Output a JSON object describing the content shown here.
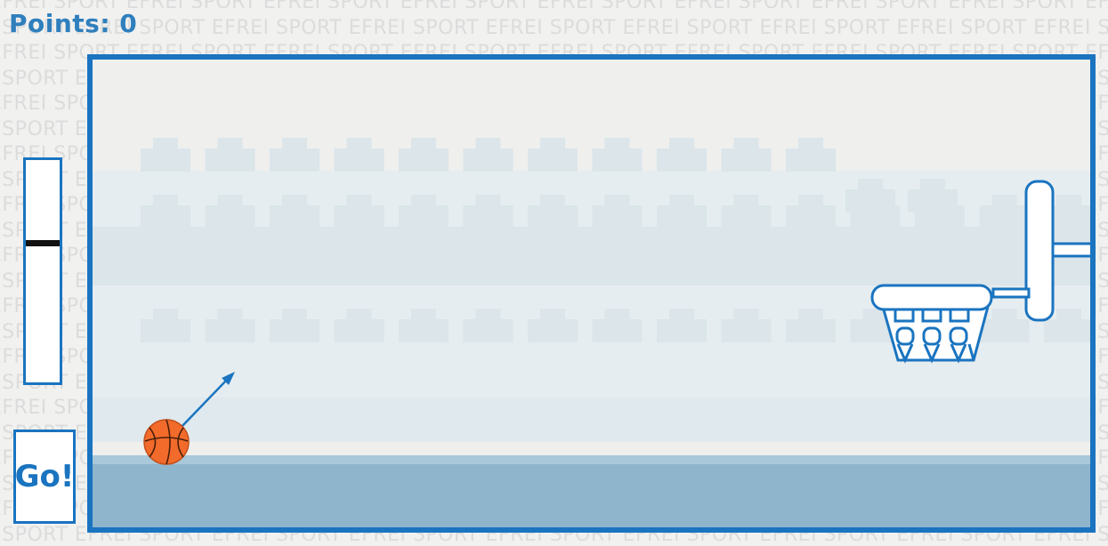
{
  "watermark": "EFREI SPORT",
  "hud": {
    "points_label": "Points: 0",
    "points": 0
  },
  "power_meter": {
    "level": 0.63
  },
  "controls": {
    "go_label": "Go!"
  },
  "colors": {
    "accent": "#1a74c0",
    "ball": "#f26b2b",
    "court_floor": "#8fb5cc",
    "stands": "#dbe5ea",
    "background": "#f1f1f0"
  },
  "icons": {
    "ball": "basketball-icon",
    "hoop": "basketball-hoop-icon",
    "aim": "aim-arrow-icon"
  }
}
